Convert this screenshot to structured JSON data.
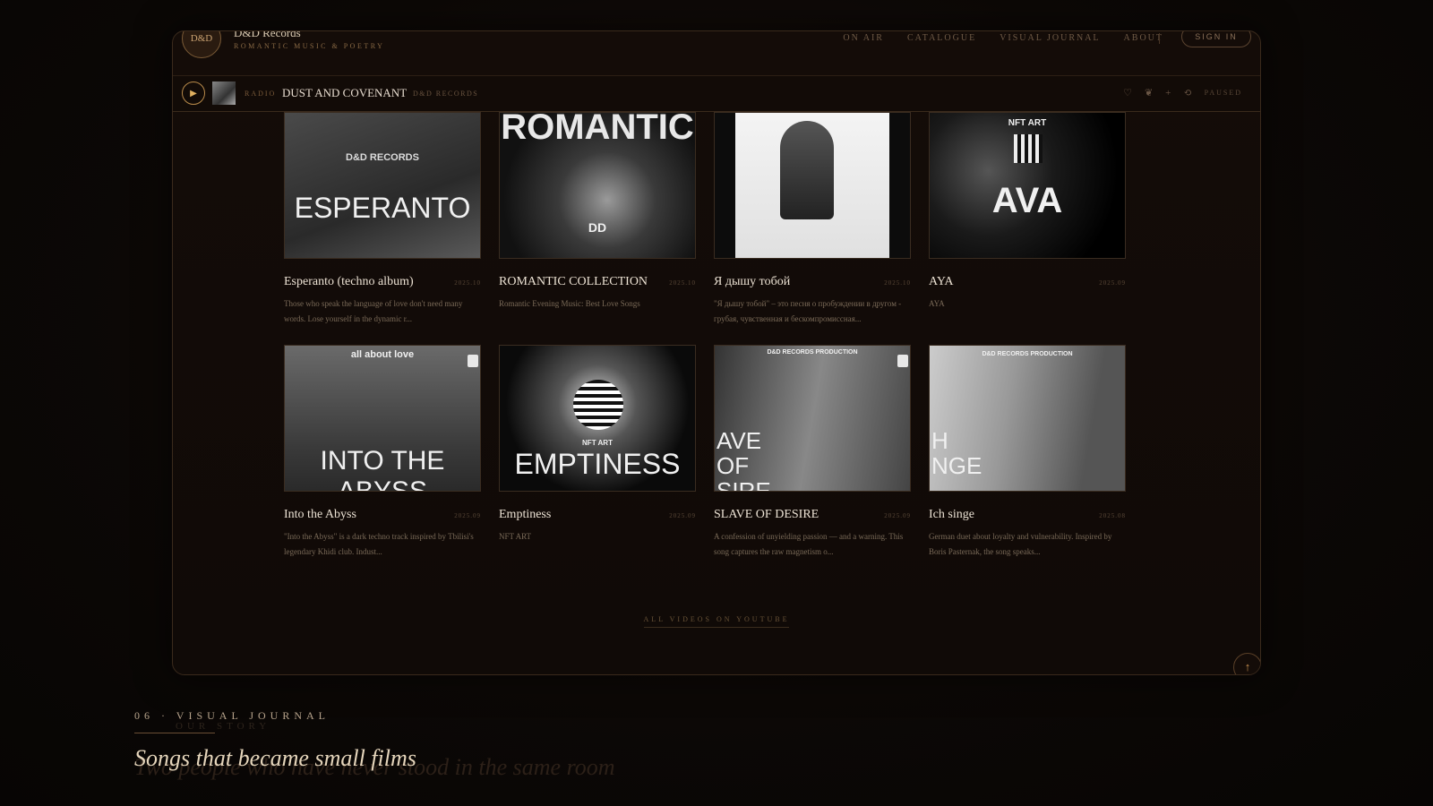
{
  "header": {
    "logo_text": "D&D",
    "brand_name": "D&D Records",
    "brand_tagline": "ROMANTIC MUSIC & POETRY",
    "nav": [
      "ON AIR",
      "CATALOGUE",
      "VISUAL JOURNAL",
      "ABOUT"
    ],
    "sign_in": "SIGN IN"
  },
  "player": {
    "play_icon": "play-icon",
    "source_label": "RADIO",
    "track_title": "DUST AND COVENANT",
    "track_artist": "D&D RECORDS",
    "status": "PAUSED"
  },
  "videos": [
    {
      "title": "Esperanto (techno album)",
      "date": "2025.10",
      "desc": "Those who speak the language of love don't need many words. Lose yourself in the dynamic r...",
      "art": "ESPERANTO",
      "art_sub": "D&D RECORDS"
    },
    {
      "title": "ROMANTIC COLLECTION",
      "date": "2025.10",
      "desc": "Romantic Evening Music: Best Love Songs",
      "art": "ROMANTIC",
      "art_sub": "DD"
    },
    {
      "title": "Я дышу тобой",
      "date": "2025.10",
      "desc": "\"Я дышу тобой\" – это песня о пробуждении в другом - грубая, чувственная и бескомпромиссная...",
      "art": "",
      "art_sub": ""
    },
    {
      "title": "AYA",
      "date": "2025.09",
      "desc": "AYA",
      "art": "AVA",
      "art_sub": "NFT ART"
    },
    {
      "title": "Into the Abyss",
      "date": "2025.09",
      "desc": "\"Into the Abyss\" is a dark techno track inspired by Tbilisi's legendary Khidi club. Indust...",
      "art": "INTO THE ABYSS",
      "art_sub": "all about love"
    },
    {
      "title": "Emptiness",
      "date": "2025.09",
      "desc": "NFT ART",
      "art": "EMPTINESS",
      "art_sub": "NFT ART"
    },
    {
      "title": "SLAVE OF DESIRE",
      "date": "2025.09",
      "desc": "A confession of unyielding passion — and a warning. This song captures the raw magnetism o...",
      "art": "AVE OF SIRE",
      "art_sub": "D&D RECORDS PRODUCTION"
    },
    {
      "title": "Ich singe",
      "date": "2025.08",
      "desc": "German duet about loyalty and vulnerability. Inspired by Boris Pasternak, the song speaks...",
      "art": "H NGE",
      "art_sub": "D&D RECORDS PRODUCTION"
    }
  ],
  "youtube_link": "ALL VIDEOS ON YOUTUBE",
  "section": {
    "label": "06 · VISUAL JOURNAL",
    "ghost_label": "OUR STORY",
    "heading": "Songs that became small films",
    "ghost_heading": "Two people who have never stood in the same room"
  }
}
